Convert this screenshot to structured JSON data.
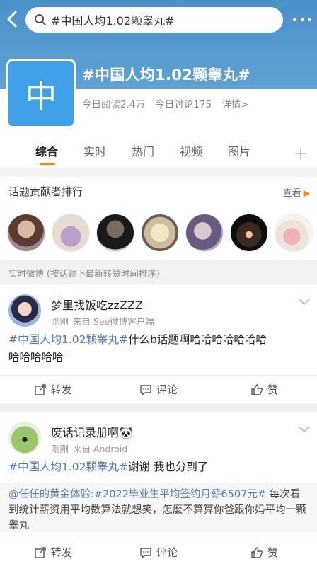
{
  "search": {
    "query": "#中国人均1.02颗睾丸#"
  },
  "topic": {
    "avatar_char": "中",
    "title": "#中国人均1.02颗睾丸#",
    "reads": "今日阅读2.4万",
    "discussions": "今日讨论175",
    "details": "详情>"
  },
  "tabs": [
    "综合",
    "实时",
    "热门",
    "视频",
    "图片"
  ],
  "contributors": {
    "heading": "话题贡献者排行",
    "more": "查看",
    "avatars": [
      "avatar-1",
      "avatar-2",
      "avatar-3",
      "avatar-4",
      "avatar-5",
      "avatar-6",
      "avatar-7"
    ]
  },
  "realtime_label": "实时微博 (按话题下最新转赞时间排序)",
  "posts": [
    {
      "user": "梦里找饭吃zzZZZ",
      "time": "刚刚",
      "source": "来自 See微博客户端",
      "tag": "#中国人均1.02颗睾丸#",
      "text_line1": "什么b话题啊哈哈哈哈哈哈哈",
      "text_line2": "哈哈哈哈哈"
    },
    {
      "user": "废话记录册啊🐼",
      "time": "刚刚",
      "source": "来自 Android",
      "tag": "#中国人均1.02颗睾丸#",
      "text": "谢谢 我也分到了",
      "quote_user": "@任任的黄金体验",
      "quote_tag": ":#2022毕业生平均签约月薪6507元#",
      "quote_text": " 每次看到统计薪资用平均数算法就想笑，怎麼不算算你爸跟你妈平均一颗睾丸"
    }
  ],
  "actions": {
    "repost": "转发",
    "comment": "评论",
    "like": "赞"
  }
}
